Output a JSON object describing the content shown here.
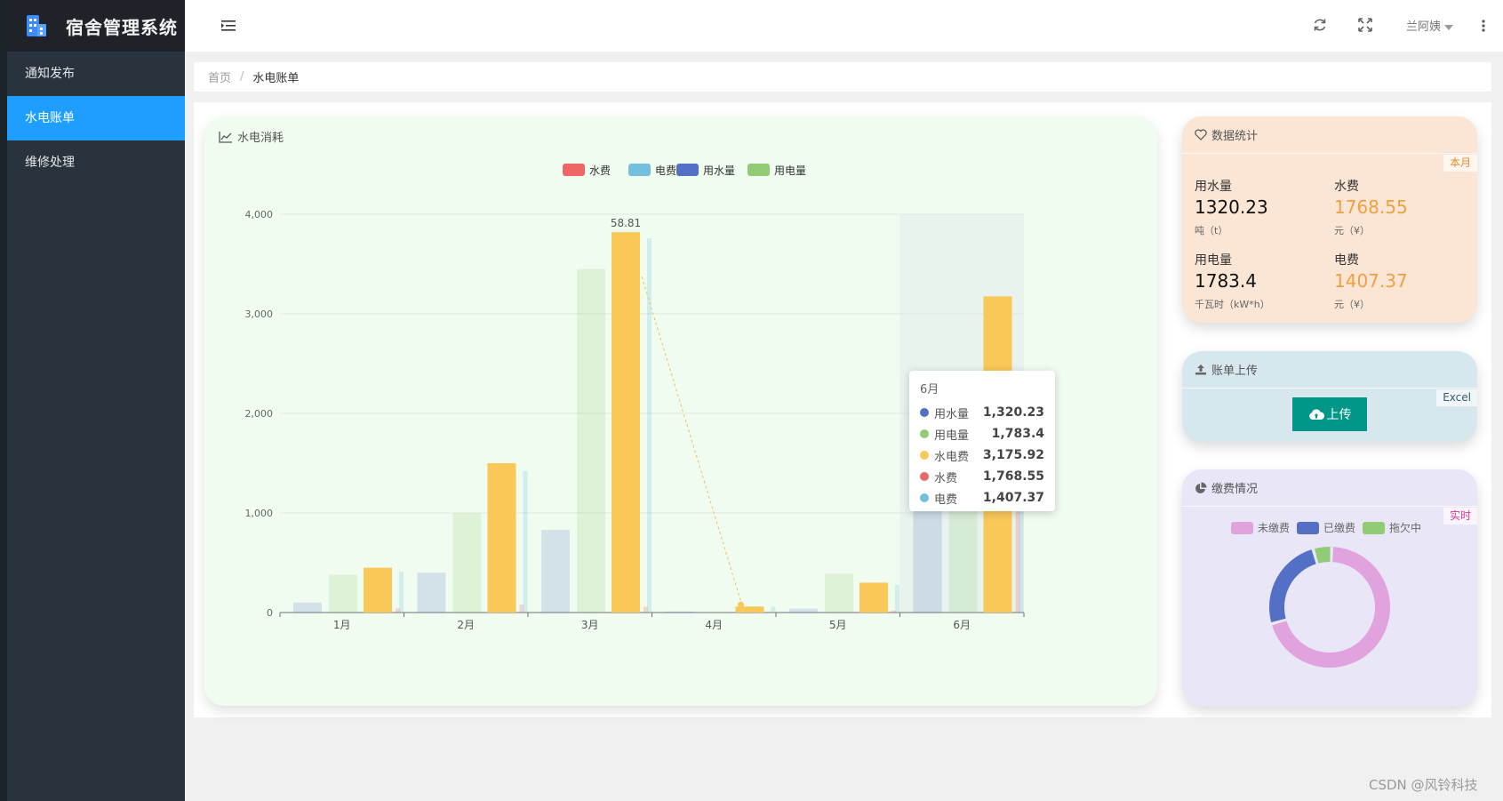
{
  "app": {
    "title": "宿舍管理系统"
  },
  "sidebar": {
    "items": [
      {
        "label": "通知发布"
      },
      {
        "label": "水电账单"
      },
      {
        "label": "维修处理"
      }
    ]
  },
  "header": {
    "user": "兰阿姨"
  },
  "breadcrumb": {
    "home": "首页",
    "separator": "/",
    "current": "水电账单"
  },
  "chart_card": {
    "title": "水电消耗"
  },
  "chart_data": {
    "type": "bar",
    "categories": [
      "1月",
      "2月",
      "3月",
      "4月",
      "5月",
      "6月"
    ],
    "legend": [
      "水费",
      "电费",
      "用水量",
      "用电量"
    ],
    "legend_colors": [
      "#ee6666",
      "#73c0de",
      "#5470c6",
      "#91cc75"
    ],
    "ylim": [
      0,
      4000
    ],
    "yticks": [
      "0",
      "1,000",
      "2,000",
      "3,000",
      "4,000"
    ],
    "series": [
      {
        "name": "用水量",
        "color": "#5470c6",
        "values": [
          100,
          400,
          830,
          10,
          40,
          1320.23
        ]
      },
      {
        "name": "用电量",
        "color": "#91cc75",
        "values": [
          380,
          1000,
          3450,
          5,
          390,
          1783.4
        ]
      },
      {
        "name": "水电费",
        "color": "#f9c858",
        "values": [
          450,
          1500,
          3820,
          60,
          300,
          3175.92
        ]
      },
      {
        "name": "水费",
        "color": "#ee6666",
        "values": [
          40,
          80,
          58.81,
          2,
          20,
          1768.55
        ]
      },
      {
        "name": "电费",
        "color": "#73c0de",
        "values": [
          410,
          1420,
          3760,
          58,
          280,
          1407.37
        ]
      }
    ],
    "label": {
      "text": "58.81",
      "category": "3月"
    },
    "highlight_category": "6月",
    "tooltip": {
      "title": "6月",
      "rows": [
        {
          "name": "用水量",
          "value": "1,320.23",
          "color": "#5470c6"
        },
        {
          "name": "用电量",
          "value": "1,783.4",
          "color": "#91cc75"
        },
        {
          "name": "水电费",
          "value": "3,175.92",
          "color": "#f9c858"
        },
        {
          "name": "水费",
          "value": "1,768.55",
          "color": "#ee6666"
        },
        {
          "name": "电费",
          "value": "1,407.37",
          "color": "#73c0de"
        }
      ]
    }
  },
  "stats": {
    "title": "数据统计",
    "tag": "本月",
    "water_usage": {
      "label": "用水量",
      "value": "1320.23",
      "unit": "吨（t）"
    },
    "water_fee": {
      "label": "水费",
      "value": "1768.55",
      "unit": "元（¥）"
    },
    "elec_usage": {
      "label": "用电量",
      "value": "1783.4",
      "unit": "千瓦时（kW*h）"
    },
    "elec_fee": {
      "label": "电费",
      "value": "1407.37",
      "unit": "元（¥）"
    }
  },
  "upload": {
    "title": "账单上传",
    "tag": "Excel",
    "button": "上传"
  },
  "payment": {
    "title": "缴费情况",
    "tag": "实时",
    "legend": [
      {
        "name": "未缴费",
        "color": "#e0a3de"
      },
      {
        "name": "已缴费",
        "color": "#5470c6"
      },
      {
        "name": "拖欠中",
        "color": "#91cc75"
      }
    ],
    "values": [
      70,
      25,
      5
    ]
  },
  "watermark": "CSDN @风铃科技",
  "colors": {
    "sidebar_active": "#1e9fff",
    "upload_button": "#009688",
    "accent_orange": "#f0a040"
  }
}
